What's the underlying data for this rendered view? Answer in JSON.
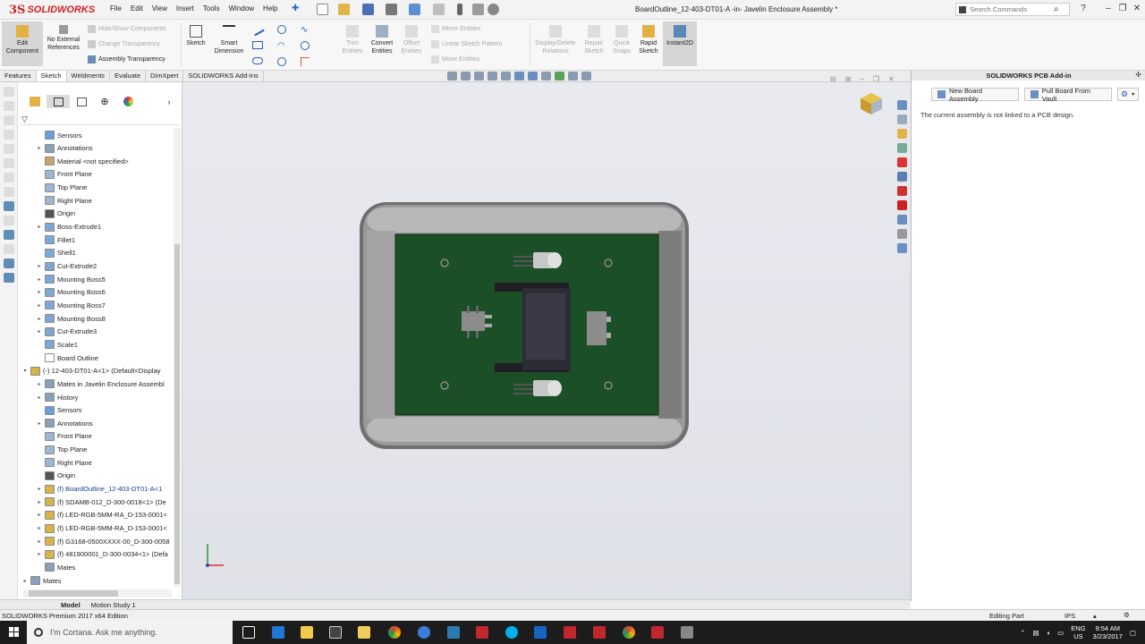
{
  "app": {
    "logo_ds": "3S",
    "logo_name": "SOLIDWORKS",
    "document_title": "BoardOutline_12-403-DT01-A -in- Javelin Enclosure Assembly *"
  },
  "menu": [
    "File",
    "Edit",
    "View",
    "Insert",
    "Tools",
    "Window",
    "Help"
  ],
  "search": {
    "placeholder": "Search Commands"
  },
  "ribbon": {
    "edit_component": "Edit Component",
    "no_external_refs": "No External References",
    "hide_show": "Hide/Show Components",
    "change_transparency": "Change Transparency",
    "assembly_transparency": "Assembly Transparency",
    "sketch": "Sketch",
    "smart_dimension": "Smart Dimension",
    "trim_entities": "Trim Entities",
    "convert_entities": "Convert Entities",
    "offset_entities": "Offset Entities",
    "mirror_entities": "Mirror Entities",
    "linear_pattern": "Linear Sketch Pattern",
    "move_entities": "Move Entities",
    "display_delete": "Display/Delete Relations",
    "repair_sketch": "Repair Sketch",
    "quick_snaps": "Quick Snaps",
    "rapid_sketch": "Rapid Sketch",
    "instant2d": "Instant2D"
  },
  "tabs": [
    "Features",
    "Sketch",
    "Weldments",
    "Evaluate",
    "DimXpert",
    "SOLIDWORKS Add-Ins"
  ],
  "tree": [
    {
      "label": "Sensors",
      "exp": "",
      "icon": "#6aa0d8"
    },
    {
      "label": "Annotations",
      "exp": "▸",
      "icon": "#8aa0b8"
    },
    {
      "label": "Material <not specified>",
      "exp": "",
      "icon": "#c9a46a"
    },
    {
      "label": "Front Plane",
      "exp": "",
      "icon": "#9fb6d0"
    },
    {
      "label": "Top Plane",
      "exp": "",
      "icon": "#9fb6d0"
    },
    {
      "label": "Right Plane",
      "exp": "",
      "icon": "#9fb6d0"
    },
    {
      "label": "Origin",
      "exp": "",
      "icon": "#555555"
    },
    {
      "label": "Boss-Extrude1",
      "exp": "▸",
      "icon": "#7fa7d6"
    },
    {
      "label": "Fillet1",
      "exp": "",
      "icon": "#7fa7d6"
    },
    {
      "label": "Shell1",
      "exp": "",
      "icon": "#7fa7d6"
    },
    {
      "label": "Cut-Extrude2",
      "exp": "▸",
      "icon": "#7fa7d6"
    },
    {
      "label": "Mounting Boss5",
      "exp": "▸",
      "icon": "#7fa7d6"
    },
    {
      "label": "Mounting Boss6",
      "exp": "▸",
      "icon": "#7fa7d6"
    },
    {
      "label": "Mounting Boss7",
      "exp": "▸",
      "icon": "#7fa7d6"
    },
    {
      "label": "Mounting Boss8",
      "exp": "▸",
      "icon": "#7fa7d6"
    },
    {
      "label": "Cut-Extrude3",
      "exp": "▸",
      "icon": "#7fa7d6"
    },
    {
      "label": "Scale1",
      "exp": "",
      "icon": "#7fa7d6"
    },
    {
      "label": "Board Outline",
      "exp": "",
      "icon": "#ffffff"
    },
    {
      "label": "(-) 12-403-DT01-A<1> (Default<Display",
      "exp": "▾",
      "icon": "#d7b34a",
      "indent": -1
    },
    {
      "label": "Mates in Javelin Enclosure Assembl",
      "exp": "▸",
      "icon": "#8aa0b8"
    },
    {
      "label": "History",
      "exp": "▸",
      "icon": "#8aa0b8"
    },
    {
      "label": "Sensors",
      "exp": "",
      "icon": "#6aa0d8"
    },
    {
      "label": "Annotations",
      "exp": "▸",
      "icon": "#8aa0b8"
    },
    {
      "label": "Front Plane",
      "exp": "",
      "icon": "#9fb6d0"
    },
    {
      "label": "Top Plane",
      "exp": "",
      "icon": "#9fb6d0"
    },
    {
      "label": "Right Plane",
      "exp": "",
      "icon": "#9fb6d0"
    },
    {
      "label": "Origin",
      "exp": "",
      "icon": "#555555"
    },
    {
      "label": "(f) BoardOutline_12-403-DT01-A<1",
      "exp": "▸",
      "icon": "#d7b34a",
      "blue": true
    },
    {
      "label": "(f) SDAMB-012_D-300-0018<1> (De",
      "exp": "▸",
      "icon": "#d7b34a"
    },
    {
      "label": "(f) LED-RGB-5MM-RA_D-153-0001<",
      "exp": "▸",
      "icon": "#d7b34a"
    },
    {
      "label": "(f) LED-RGB-5MM-RA_D-153-0001<",
      "exp": "▸",
      "icon": "#d7b34a"
    },
    {
      "label": "(f) G3168-0500XXXX-00_D-300-0058",
      "exp": "▸",
      "icon": "#d7b34a"
    },
    {
      "label": "(f) 481900001_D-300-0034<1> (Defa",
      "exp": "▸",
      "icon": "#d7b34a"
    },
    {
      "label": "Mates",
      "exp": "",
      "icon": "#8aa0b8"
    },
    {
      "label": "Mates",
      "exp": "▸",
      "icon": "#8aa0b8",
      "indent": -2
    }
  ],
  "pcb_panel": {
    "title": "SOLIDWORKS PCB Add-in",
    "new_board": "New Board Assembly",
    "pull_board": "Pull Board From Vault",
    "message": "The current assembly is not linked to a PCB design."
  },
  "bottom_tabs": [
    "Model",
    "Motion Study 1"
  ],
  "status": {
    "edition": "SOLIDWORKS Premium 2017 x64 Edition",
    "mode": "Editing Part",
    "units": "IPS"
  },
  "taskbar": {
    "cortana": "I'm Cortana. Ask me anything.",
    "lang": "ENG",
    "region": "US",
    "time": "9:54 AM",
    "date": "3/23/2017"
  },
  "colors": {
    "board": "#1b4f27",
    "enclosure": "#8e8e8e",
    "accent": "#d11f26",
    "viewport": "#e5e6ec"
  }
}
